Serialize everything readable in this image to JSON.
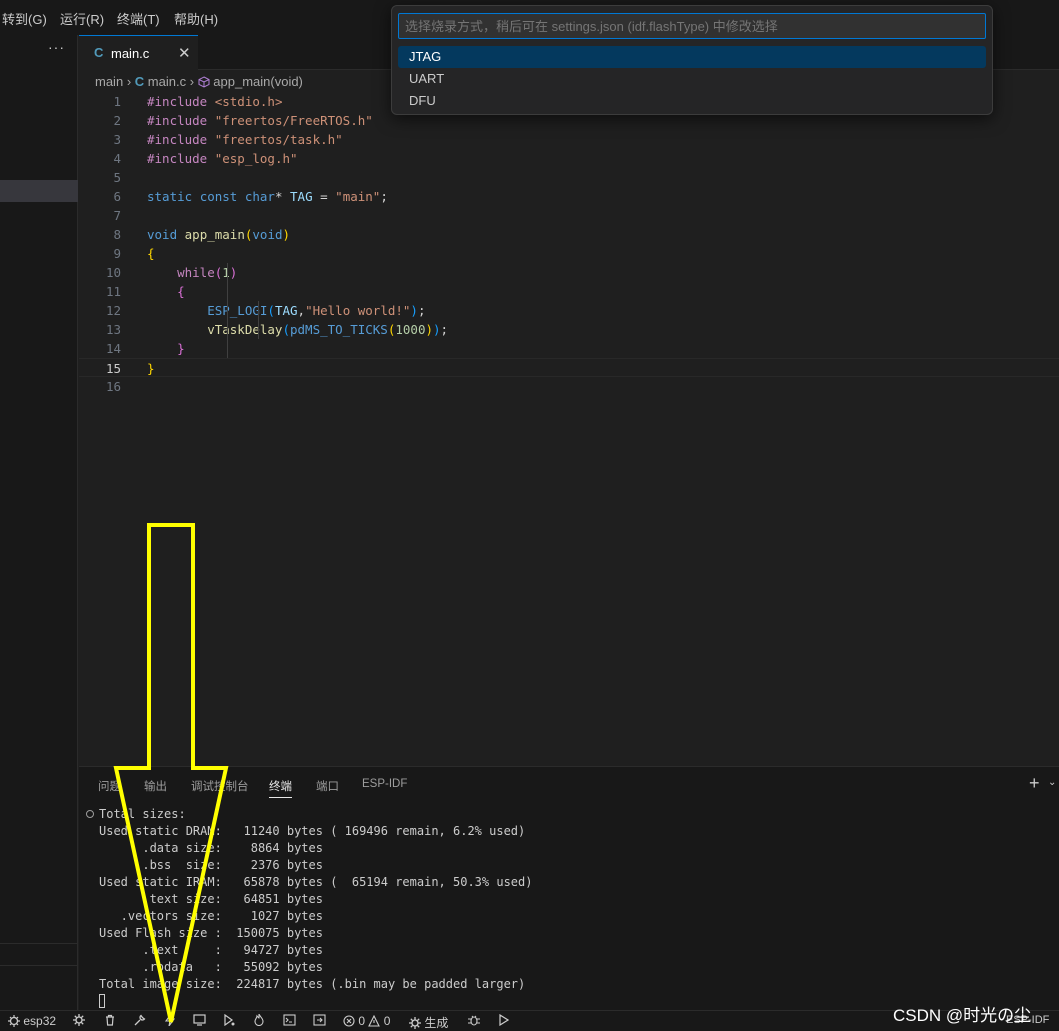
{
  "menubar": {
    "items": [
      "转到(G)",
      "运行(R)",
      "终端(T)",
      "帮助(H)"
    ]
  },
  "sidebar": {
    "more_label": "···"
  },
  "tabs": {
    "active": {
      "icon": "C",
      "label": "main.c",
      "close": "✕"
    }
  },
  "breadcrumb": {
    "folder": "main",
    "file_icon": "C",
    "file": "main.c",
    "symbol": "app_main(void)"
  },
  "editor": {
    "line_numbers": [
      "1",
      "2",
      "3",
      "4",
      "5",
      "6",
      "7",
      "8",
      "9",
      "10",
      "11",
      "12",
      "13",
      "14",
      "15",
      "16"
    ],
    "active_line": "15",
    "lines": [
      [
        {
          "t": "#include ",
          "c": "pp"
        },
        {
          "t": "<stdio.h>",
          "c": "str"
        }
      ],
      [
        {
          "t": "#include ",
          "c": "pp"
        },
        {
          "t": "\"freertos/FreeRTOS.h\"",
          "c": "str"
        }
      ],
      [
        {
          "t": "#include ",
          "c": "pp"
        },
        {
          "t": "\"freertos/task.h\"",
          "c": "str"
        }
      ],
      [
        {
          "t": "#include ",
          "c": "pp"
        },
        {
          "t": "\"esp_log.h\"",
          "c": "str"
        }
      ],
      [],
      [
        {
          "t": "static ",
          "c": "kw"
        },
        {
          "t": "const ",
          "c": "kw"
        },
        {
          "t": "char",
          "c": "ty"
        },
        {
          "t": "* ",
          "c": "op"
        },
        {
          "t": "TAG",
          "c": "id"
        },
        {
          "t": " = ",
          "c": "op"
        },
        {
          "t": "\"main\"",
          "c": "str"
        },
        {
          "t": ";",
          "c": "op"
        }
      ],
      [],
      [
        {
          "t": "void ",
          "c": "kw"
        },
        {
          "t": "app_main",
          "c": "fn"
        },
        {
          "t": "(",
          "c": "br1"
        },
        {
          "t": "void",
          "c": "kw"
        },
        {
          "t": ")",
          "c": "br1"
        }
      ],
      [
        {
          "t": "{",
          "c": "br1"
        }
      ],
      [
        {
          "t": "    while",
          "c": "ctl"
        },
        {
          "t": "(",
          "c": "br2"
        },
        {
          "t": "1",
          "c": "num"
        },
        {
          "t": ")",
          "c": "br2"
        }
      ],
      [
        {
          "t": "    {",
          "c": "br2"
        }
      ],
      [
        {
          "t": "        ESP_LOGI",
          "c": "mac"
        },
        {
          "t": "(",
          "c": "br3"
        },
        {
          "t": "TAG",
          "c": "id"
        },
        {
          "t": ",",
          "c": "op"
        },
        {
          "t": "\"Hello world!\"",
          "c": "str"
        },
        {
          "t": ")",
          "c": "br3"
        },
        {
          "t": ";",
          "c": "op"
        }
      ],
      [
        {
          "t": "        vTaskDelay",
          "c": "fn"
        },
        {
          "t": "(",
          "c": "br3"
        },
        {
          "t": "pdMS_TO_TICKS",
          "c": "mac"
        },
        {
          "t": "(",
          "c": "br1"
        },
        {
          "t": "1000",
          "c": "num"
        },
        {
          "t": ")",
          "c": "br1"
        },
        {
          "t": ")",
          "c": "br3"
        },
        {
          "t": ";",
          "c": "op"
        }
      ],
      [
        {
          "t": "    }",
          "c": "br2"
        }
      ],
      [
        {
          "t": "}",
          "c": "br1"
        }
      ],
      []
    ]
  },
  "quickpick": {
    "placeholder": "选择烧录方式，稍后可在 settings.json (idf.flashType) 中修改选择",
    "items": [
      "JTAG",
      "UART",
      "DFU"
    ],
    "selected": "JTAG"
  },
  "panel": {
    "tabs": [
      "问题",
      "输出",
      "调试控制台",
      "终端",
      "端口",
      "ESP-IDF"
    ],
    "active_tab": "终端",
    "plus": "+",
    "chevron": "⌄",
    "terminal_lines": [
      "Total sizes:",
      "Used static DRAM:   11240 bytes ( 169496 remain, 6.2% used)",
      "      .data size:    8864 bytes",
      "      .bss  size:    2376 bytes",
      "Used static IRAM:   65878 bytes (  65194 remain, 50.3% used)",
      "      .text size:   64851 bytes",
      "   .vectors size:    1027 bytes",
      "Used Flash size :  150075 bytes",
      "      .text     :   94727 bytes",
      "      .rodata   :   55092 bytes",
      "Total image size:  224817 bytes (.bin may be padded larger)"
    ]
  },
  "statusbar": {
    "target": "esp32",
    "errors": "0",
    "warnings": "0",
    "build_label": "生成",
    "right_label": "ESP-IDF"
  },
  "watermark": "CSDN @时光の尘",
  "colors": {
    "accent": "#0078d4",
    "arrow": "#ffff00",
    "selection": "#04395e"
  }
}
